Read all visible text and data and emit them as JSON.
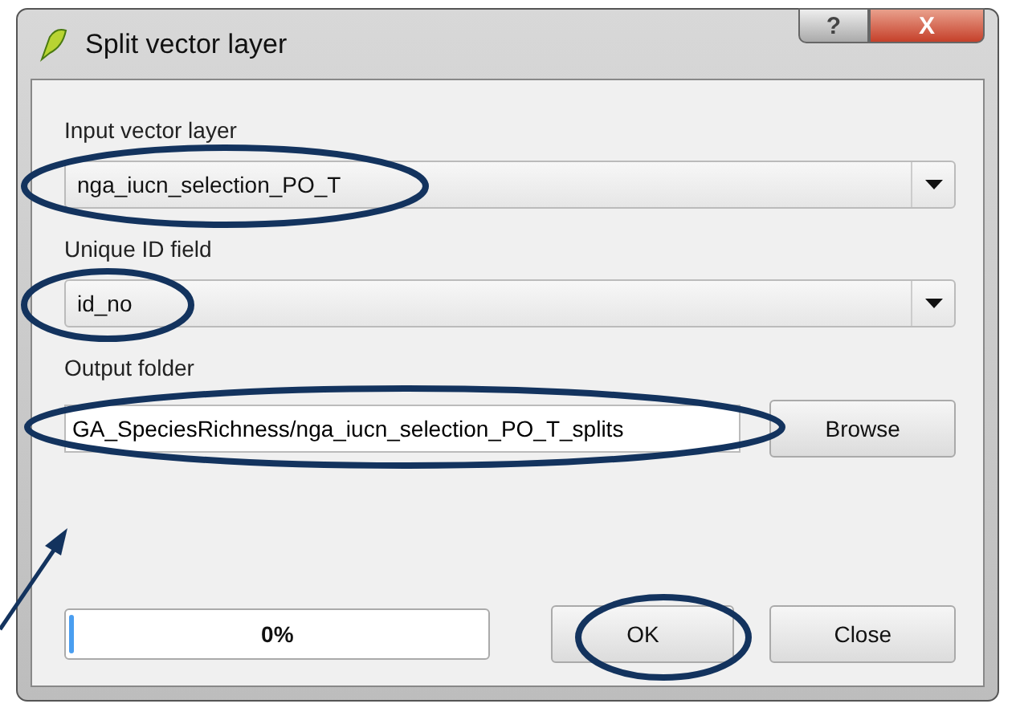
{
  "window": {
    "title": "Split vector layer",
    "buttons": [
      "?",
      "X"
    ]
  },
  "fields": [
    {
      "kind": "combo",
      "label": "Input vector layer",
      "value": "nga_iucn_selection_PO_T"
    },
    {
      "kind": "combo",
      "label": "Unique ID field",
      "value": "id_no"
    },
    {
      "kind": "text",
      "label": "Output folder",
      "value": "GA_SpeciesRichness/nga_iucn_selection_PO_T_splits",
      "button": "Browse"
    }
  ],
  "progress": {
    "level": 0.01,
    "reading": "0%"
  },
  "buttons": [
    "OK",
    "Close"
  ]
}
